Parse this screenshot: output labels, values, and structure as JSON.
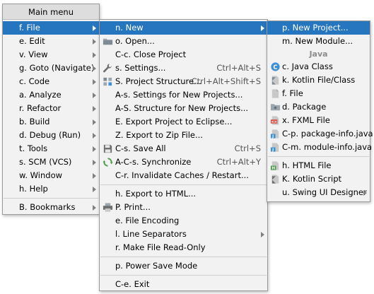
{
  "main_menu": {
    "title": "Main menu",
    "items": [
      {
        "label": "f. File",
        "submenu": true,
        "selected": true
      },
      {
        "label": "e. Edit",
        "submenu": true
      },
      {
        "label": "v. View",
        "submenu": true
      },
      {
        "label": "g. Goto (Navigate)",
        "submenu": true
      },
      {
        "label": "c. Code",
        "submenu": true
      },
      {
        "label": "a. Analyze",
        "submenu": true
      },
      {
        "label": "r. Refactor",
        "submenu": true
      },
      {
        "label": "b. Build",
        "submenu": true
      },
      {
        "label": "d. Debug (Run)",
        "submenu": true
      },
      {
        "label": "t. Tools",
        "submenu": true
      },
      {
        "label": "s. SCM (VCS)",
        "submenu": true
      },
      {
        "label": "w. Window",
        "submenu": true
      },
      {
        "label": "h. Help",
        "submenu": true
      }
    ],
    "bookmarks": {
      "label": "B. Bookmarks",
      "submenu": true
    }
  },
  "file_menu": {
    "group1": [
      {
        "label": "n. New",
        "submenu": true,
        "selected": true
      },
      {
        "label": "o. Open...",
        "icon": "folder-icon"
      },
      {
        "label": "C-c. Close Project"
      },
      {
        "label": "s. Settings...",
        "shortcut": "Ctrl+Alt+S",
        "icon": "wrench-icon"
      },
      {
        "label": "S. Project Structure...",
        "shortcut": "Ctrl+Alt+Shift+S",
        "icon": "project-structure-icon"
      },
      {
        "label": "A-s. Settings for New Projects..."
      },
      {
        "label": "A-S. Structure for New Projects..."
      },
      {
        "label": "E. Export Project to Eclipse..."
      },
      {
        "label": "Z. Export to Zip File..."
      },
      {
        "label": "C-s. Save All",
        "shortcut": "Ctrl+S",
        "icon": "save-icon"
      },
      {
        "label": "A-C-s. Synchronize",
        "shortcut": "Ctrl+Alt+Y",
        "icon": "sync-icon"
      },
      {
        "label": "C-r. Invalidate Caches / Restart..."
      }
    ],
    "group2": [
      {
        "label": "h. Export to HTML..."
      },
      {
        "label": "P. Print...",
        "icon": "print-icon"
      },
      {
        "label": "e. File Encoding"
      },
      {
        "label": "l. Line Separators",
        "submenu": true
      },
      {
        "label": "r. Make File Read-Only"
      }
    ],
    "group3": [
      {
        "label": "p. Power Save Mode"
      }
    ],
    "group4": [
      {
        "label": "C-e. Exit"
      }
    ]
  },
  "new_menu": {
    "group1": [
      {
        "label": "p. New Project...",
        "selected": true
      },
      {
        "label": "m. New Module..."
      }
    ],
    "java_header": "Java",
    "group2": [
      {
        "label": "c. Java Class",
        "icon": "java-class-icon"
      },
      {
        "label": "k. Kotlin File/Class",
        "icon": "kotlin-file-icon"
      },
      {
        "label": "f. File",
        "icon": "file-icon"
      },
      {
        "label": "d. Package",
        "icon": "package-icon"
      },
      {
        "label": "x. FXML File",
        "icon": "fxml-file-icon"
      },
      {
        "label": "C-p. package-info.java",
        "icon": "package-info-icon"
      },
      {
        "label": "C-m. module-info.java",
        "icon": "module-info-icon"
      }
    ],
    "group3": [
      {
        "label": "h. HTML File",
        "icon": "html-file-icon"
      },
      {
        "label": "K. Kotlin Script",
        "icon": "kotlin-script-icon"
      },
      {
        "label": "u. Swing UI Designer",
        "submenu": true
      }
    ]
  },
  "colors": {
    "selection": "#2675bf",
    "menu_bg": "#f2f2f2",
    "separator": "#cfcfcf"
  }
}
